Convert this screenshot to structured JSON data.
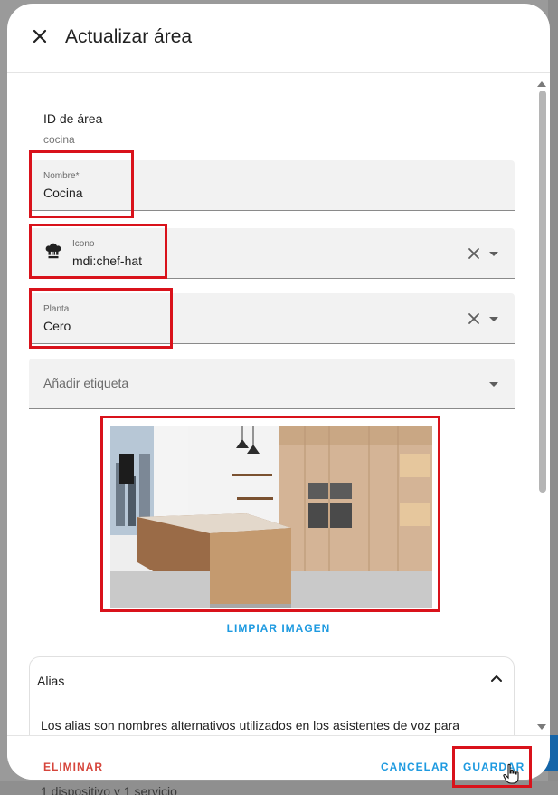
{
  "dialog": {
    "title": "Actualizar área",
    "close_icon": "close-icon"
  },
  "area_id": {
    "label": "ID de área",
    "value": "cocina"
  },
  "name_field": {
    "label": "Nombre*",
    "value": "Cocina"
  },
  "icon_field": {
    "label": "Icono",
    "value": "mdi:chef-hat",
    "icon": "chef-hat-icon"
  },
  "floor_field": {
    "label": "Planta",
    "value": "Cero"
  },
  "label_field": {
    "placeholder": "Añadir etiqueta"
  },
  "image": {
    "clear_label": "LIMPIAR IMAGEN"
  },
  "alias": {
    "title": "Alias",
    "description": "Los alias son nombres alternativos utilizados en los asistentes de voz para"
  },
  "footer": {
    "delete_label": "ELIMINAR",
    "cancel_label": "CANCELAR",
    "save_label": "GUARDAR"
  },
  "background": {
    "text": "1 dispositivo y 1 servicio"
  },
  "colors": {
    "accent": "#1e9ae0",
    "danger": "#d6453b",
    "highlight": "#d9121b"
  }
}
